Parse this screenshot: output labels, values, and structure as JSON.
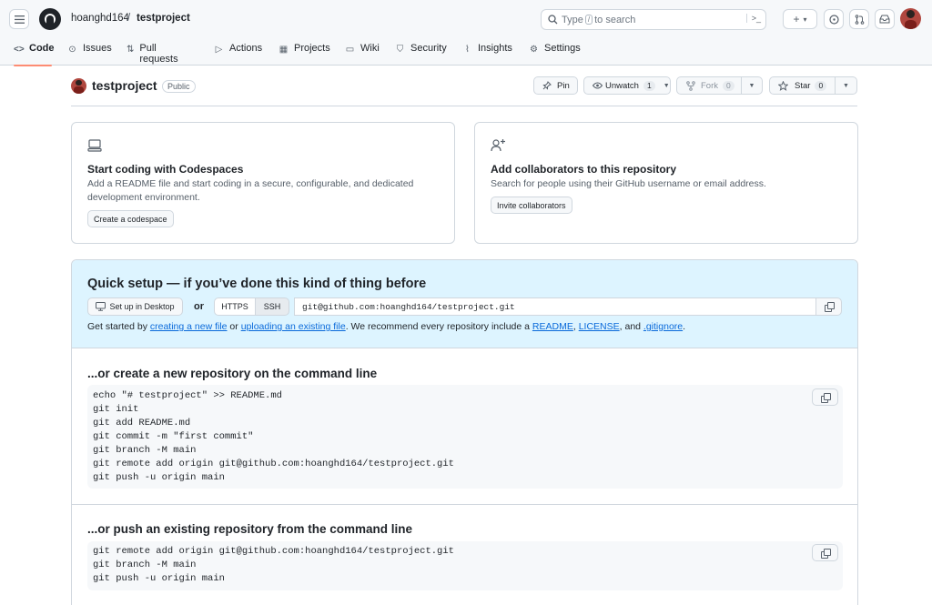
{
  "header": {
    "owner": "hoanghd164",
    "separator": "/",
    "repo": "testproject",
    "search_prefix": "Type",
    "search_key": "/",
    "search_suffix": "to search",
    "prompt_icon": ">_",
    "plus": "+",
    "caret": "▾"
  },
  "tabs": [
    {
      "label": "Code",
      "icon": "code-icon",
      "glyph": "<>"
    },
    {
      "label": "Issues",
      "icon": "issue-icon",
      "glyph": "⊙"
    },
    {
      "label": "Pull requests",
      "icon": "pull-request-icon",
      "glyph": "⇅"
    },
    {
      "label": "Actions",
      "icon": "play-icon",
      "glyph": "▷"
    },
    {
      "label": "Projects",
      "icon": "table-icon",
      "glyph": "▦"
    },
    {
      "label": "Wiki",
      "icon": "book-icon",
      "glyph": "▭"
    },
    {
      "label": "Security",
      "icon": "shield-icon",
      "glyph": "⛉"
    },
    {
      "label": "Insights",
      "icon": "graph-icon",
      "glyph": "⌇"
    },
    {
      "label": "Settings",
      "icon": "gear-icon",
      "glyph": "⚙"
    }
  ],
  "repo": {
    "name": "testproject",
    "visibility": "Public",
    "pin": "Pin",
    "unwatch": "Unwatch",
    "watch_count": "1",
    "fork": "Fork",
    "fork_count": "0",
    "star": "Star",
    "star_count": "0"
  },
  "codespaces_card": {
    "title": "Start coding with Codespaces",
    "desc": "Add a README file and start coding in a secure, configurable, and dedicated development environment.",
    "button": "Create a codespace"
  },
  "collab_card": {
    "title": "Add collaborators to this repository",
    "desc": "Search for people using their GitHub username or email address.",
    "button": "Invite collaborators"
  },
  "quick_setup": {
    "title": "Quick setup — if you’ve done this kind of thing before",
    "desktop_button": "Set up in Desktop",
    "or": "or",
    "https": "HTTPS",
    "ssh": "SSH",
    "url": "git@github.com:hoanghd164/testproject.git",
    "help": {
      "t1": "Get started by ",
      "l1": "creating a new file",
      "t2": " or ",
      "l2": "uploading an existing file",
      "t3": ". We recommend every repository include a ",
      "l3": "README",
      "t4": ", ",
      "l4": "LICENSE",
      "t5": ", and ",
      "l5": ".gitignore",
      "t6": "."
    }
  },
  "new_repo": {
    "title": "...or create a new repository on the command line",
    "lines": [
      "echo \"# testproject\" >> README.md",
      "git init",
      "git add README.md",
      "git commit -m \"first commit\"",
      "git branch -M main",
      "git remote add origin git@github.com:hoanghd164/testproject.git",
      "git push -u origin main"
    ]
  },
  "push_existing": {
    "title": "...or push an existing repository from the command line",
    "lines": [
      "git remote add origin git@github.com:hoanghd164/testproject.git",
      "git branch -M main",
      "git push -u origin main"
    ]
  },
  "colors": {
    "accent_underline": "#fd8c73",
    "link": "#0969da",
    "quick_bg": "#ddf4ff",
    "border": "#d0d7de"
  }
}
